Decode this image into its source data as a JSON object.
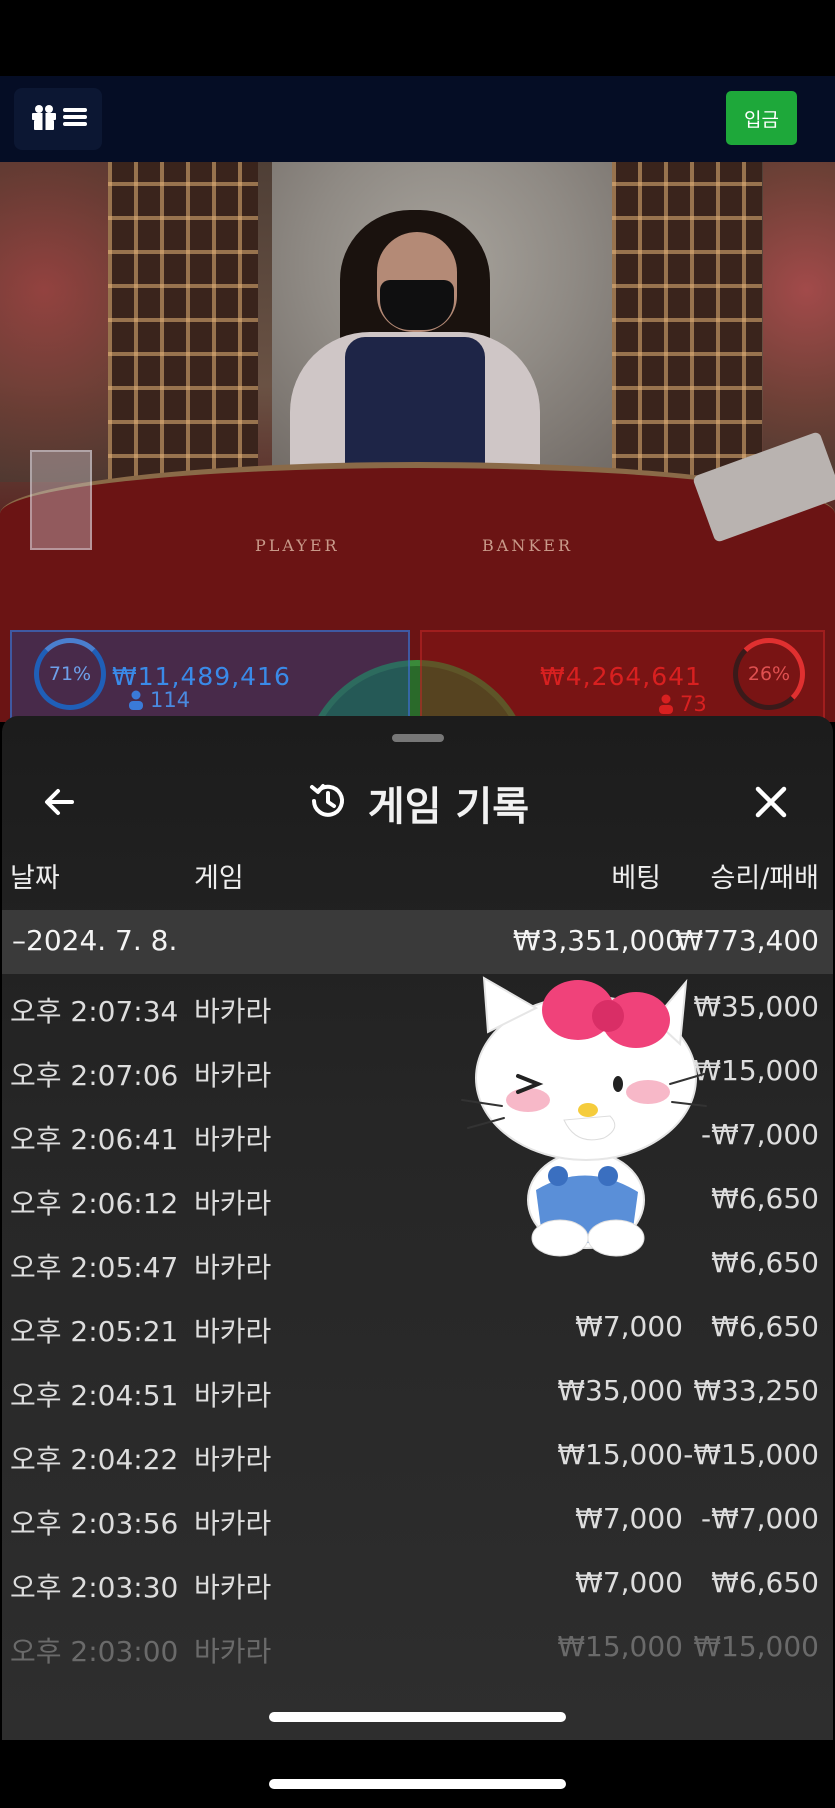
{
  "top_bar": {
    "deposit_label": "입금"
  },
  "stats": {
    "player_percent": "71%",
    "player_amount": "₩11,489,416",
    "player_count": "114",
    "banker_percent": "26%",
    "banker_amount": "₩4,264,641",
    "banker_count": "73"
  },
  "table_labels": {
    "player": "PLAYER",
    "banker": "BANKER"
  },
  "panel": {
    "title": "게임 기록",
    "columns": {
      "date": "날짜",
      "game": "게임",
      "bet": "베팅",
      "result": "승리/패배"
    },
    "summary": {
      "date": "–2024. 7. 8.",
      "bet": "₩3,351,000",
      "result": "₩773,400"
    },
    "rows": [
      {
        "time": "오후 2:07:34",
        "game": "바카라",
        "bet": "",
        "result": "₩35,000"
      },
      {
        "time": "오후 2:07:06",
        "game": "바카라",
        "bet": "",
        "result": "-₩15,000"
      },
      {
        "time": "오후 2:06:41",
        "game": "바카라",
        "bet": "",
        "result": "-₩7,000"
      },
      {
        "time": "오후 2:06:12",
        "game": "바카라",
        "bet": "",
        "result": "₩6,650"
      },
      {
        "time": "오후 2:05:47",
        "game": "바카라",
        "bet": "",
        "result": "₩6,650"
      },
      {
        "time": "오후 2:05:21",
        "game": "바카라",
        "bet": "₩7,000",
        "result": "₩6,650"
      },
      {
        "time": "오후 2:04:51",
        "game": "바카라",
        "bet": "₩35,000",
        "result": "₩33,250"
      },
      {
        "time": "오후 2:04:22",
        "game": "바카라",
        "bet": "₩15,000",
        "result": "-₩15,000"
      },
      {
        "time": "오후 2:03:56",
        "game": "바카라",
        "bet": "₩7,000",
        "result": "-₩7,000"
      },
      {
        "time": "오후 2:03:30",
        "game": "바카라",
        "bet": "₩7,000",
        "result": "₩6,650"
      },
      {
        "time": "오후 2:03:00",
        "game": "바카라",
        "bet": "₩15,000",
        "result": "₩15,000"
      }
    ]
  },
  "icons": {
    "menu": "gift-menu-icon",
    "back": "arrow-left-icon",
    "history": "history-icon",
    "close": "close-icon"
  },
  "colors": {
    "deposit": "#1ea83a",
    "player": "#3a8ae8",
    "banker": "#d82020",
    "panel_bg": "#262626"
  }
}
